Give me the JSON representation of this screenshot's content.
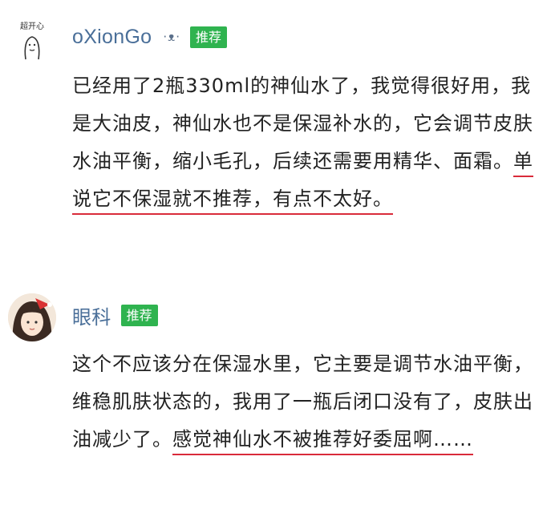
{
  "comments": [
    {
      "username": "oXionGo",
      "kaomoji": "·ᴥ·",
      "tag": "推荐",
      "text_plain": "已经用了2瓶330ml的神仙水了，我觉得很好用，我是大油皮，神仙水也不是保湿补水的，它会调节皮肤水油平衡，缩小毛孔，后续还需要用精华、面霜。",
      "text_highlight": "单说它不保湿就不推荐，有点不太好。",
      "avatar_caption": "超开心"
    },
    {
      "username": "眼科",
      "tag": "推荐",
      "text_plain": "这个不应该分在保湿水里，它主要是调节水油平衡，维稳肌肤状态的，我用了一瓶后闭口没有了，皮肤出油减少了。",
      "text_highlight": "感觉神仙水不被推荐好委屈啊……"
    }
  ],
  "colors": {
    "username": "#4a6f99",
    "tag_bg": "#2fb34f",
    "underline": "#d92b3a",
    "text": "#222222"
  }
}
